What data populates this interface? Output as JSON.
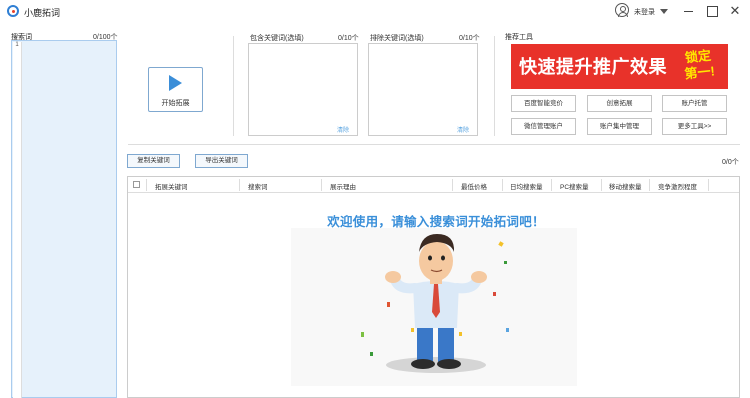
{
  "window": {
    "title": "小鹿拓词",
    "login_status": "未登录"
  },
  "left_panel": {
    "label": "搜索词",
    "count": "0/100个",
    "line_number": "1"
  },
  "start_button": {
    "label": "开始拓展"
  },
  "include_keywords": {
    "label": "包含关键词(选填)",
    "count": "0/10个",
    "clear_label": "清除"
  },
  "exclude_keywords": {
    "label": "排除关键词(选填)",
    "count": "0/10个",
    "clear_label": "清除"
  },
  "tools": {
    "title": "推荐工具",
    "banner_text": "快速提升推广效果",
    "banner_badge_line1": "锁定",
    "banner_badge_line2": "第一!",
    "buttons": [
      "百度智能竞价",
      "创意拓展",
      "账户托管",
      "微信管理账户",
      "账户集中管理",
      "更多工具>>"
    ]
  },
  "actions": {
    "copy_label": "复制关键词",
    "export_label": "导出关键词",
    "result_count": "0/0个"
  },
  "table": {
    "columns": [
      "拓展关键词",
      "搜索词",
      "展示理由",
      "最低价格",
      "日均搜索量",
      "PC搜索量",
      "移动搜索量",
      "竞争激烈程度"
    ]
  },
  "welcome_message": "欢迎使用，请输入搜索词开始拓词吧！",
  "colors": {
    "accent": "#3a8fd9",
    "banner": "#e8322a",
    "badge": "#ffe600"
  }
}
